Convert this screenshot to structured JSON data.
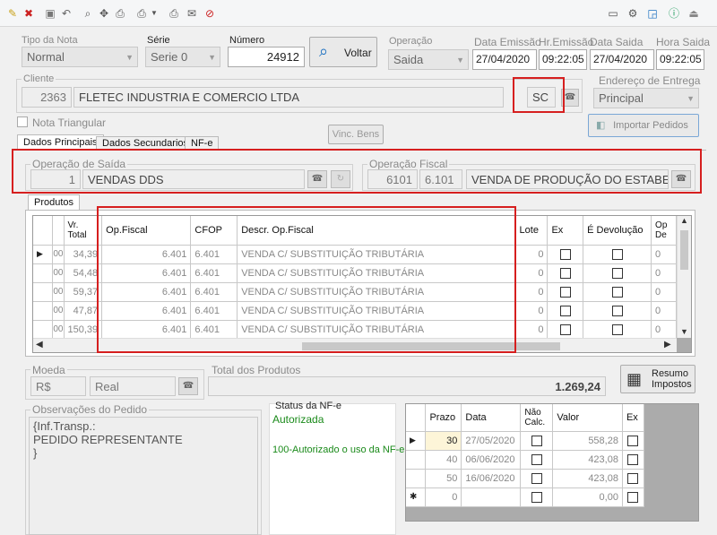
{
  "toolbar": {
    "icons": [
      "edit-icon",
      "cancel-icon",
      "save-icon",
      "undo-icon",
      "search-icon",
      "move-icon",
      "print-icon",
      "print-dropdown-icon",
      "printer-icon",
      "email-icon",
      "block-icon"
    ],
    "right_icons": [
      "screen-icon",
      "settings-icon",
      "window-icon",
      "help-icon",
      "exit-icon"
    ]
  },
  "header": {
    "tipo_nota_label": "Tipo da Nota",
    "tipo_nota_value": "Normal",
    "serie_label": "Série",
    "serie_value": "Serie 0",
    "numero_label": "Número",
    "numero_value": "24912",
    "voltar_label": "Voltar",
    "operacao_label": "Operação",
    "operacao_value": "Saida",
    "data_emissao_label": "Data Emissão",
    "data_emissao_value": "27/04/2020",
    "hr_emissao_label": "Hr.Emissão",
    "hr_emissao_value": "09:22:05",
    "data_saida_label": "Data Saida",
    "data_saida_value": "27/04/2020",
    "hora_saida_label": "Hora Saida",
    "hora_saida_value": "09:22:05"
  },
  "cliente": {
    "label": "Cliente",
    "code": "2363",
    "name": "FLETEC INDUSTRIA E COMERCIO LTDA",
    "uf": "SC",
    "endereco_label": "Endereço de Entrega",
    "endereco_value": "Principal",
    "nota_triangular_label": "Nota Triangular",
    "vinc_bens_label": "Vinc. Bens",
    "importar_label": "Importar Pedidos"
  },
  "tabs": [
    "Dados Principais",
    "Dados Secundarios",
    "NF-e"
  ],
  "operacao_saida": {
    "label": "Operação de Saída",
    "code": "1",
    "desc": "VENDAS DDS"
  },
  "operacao_fiscal": {
    "label": "Operação Fiscal",
    "code": "6101",
    "cfop": "6.101",
    "desc": "VENDA DE PRODUÇÃO DO ESTABE"
  },
  "produtos": {
    "tab_label": "Produtos",
    "headers": {
      "vr_total": "Vr.\nTotal",
      "op_fiscal": "Op.Fiscal",
      "cfop": "CFOP",
      "descr": "Descr. Op.Fiscal",
      "lote": "Lote",
      "ex": "Ex",
      "devolucao": "É Devolução",
      "op_de": "Op\nDe"
    },
    "rows": [
      {
        "pre": "00",
        "total": "34,39",
        "op": "6.401",
        "cfop": "6.401",
        "descr": "VENDA C/ SUBSTITUIÇÃO TRIBUTÁRIA",
        "lote": "0",
        "op_de": "0"
      },
      {
        "pre": "00",
        "total": "54,48",
        "op": "6.401",
        "cfop": "6.401",
        "descr": "VENDA C/ SUBSTITUIÇÃO TRIBUTÁRIA",
        "lote": "0",
        "op_de": "0"
      },
      {
        "pre": "00",
        "total": "59,37",
        "op": "6.401",
        "cfop": "6.401",
        "descr": "VENDA C/ SUBSTITUIÇÃO TRIBUTÁRIA",
        "lote": "0",
        "op_de": "0"
      },
      {
        "pre": "00",
        "total": "47,87",
        "op": "6.401",
        "cfop": "6.401",
        "descr": "VENDA C/ SUBSTITUIÇÃO TRIBUTÁRIA",
        "lote": "0",
        "op_de": "0"
      },
      {
        "pre": "00",
        "total": "150,39",
        "op": "6.401",
        "cfop": "6.401",
        "descr": "VENDA C/ SUBSTITUIÇÃO TRIBUTÁRIA",
        "lote": "0",
        "op_de": "0"
      }
    ]
  },
  "moeda": {
    "label": "Moeda",
    "code": "R$",
    "name": "Real"
  },
  "total_produtos": {
    "label": "Total dos Produtos",
    "value": "1.269,24"
  },
  "resumo_label": "Resumo\nImpostos",
  "observacoes": {
    "label": "Observações do Pedido",
    "text": "{Inf.Transp.:\nPEDIDO REPRESENTANTE\n}"
  },
  "status_nfe": {
    "label": "Status da NF-e",
    "status": "Autorizada",
    "message": "100-Autorizado o uso da NF-e"
  },
  "prazos": {
    "headers": {
      "prazo": "Prazo",
      "data": "Data",
      "nao_calc": "Não\nCalc.",
      "valor": "Valor",
      "ex": "Ex"
    },
    "rows": [
      {
        "prazo": "30",
        "data": "27/05/2020",
        "valor": "558,28"
      },
      {
        "prazo": "40",
        "data": "06/06/2020",
        "valor": "423,08"
      },
      {
        "prazo": "50",
        "data": "16/06/2020",
        "valor": "423,08"
      },
      {
        "prazo": "0",
        "data": "",
        "valor": "0,00"
      }
    ]
  },
  "colors": {
    "status_green": "#1a8a1a",
    "highlight_red": "#d61f1f"
  }
}
